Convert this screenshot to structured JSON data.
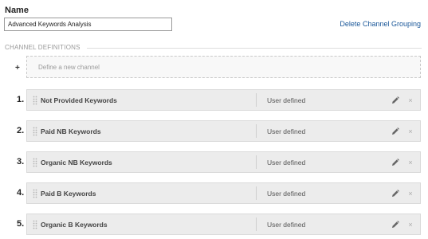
{
  "name_section": {
    "label": "Name",
    "value": "Advanced Keywords Analysis"
  },
  "delete_link": "Delete Channel Grouping",
  "channel_definitions": {
    "heading": "CHANNEL DEFINITIONS",
    "add_symbol": "+",
    "define_new_label": "Define a new channel",
    "channels": [
      {
        "number": "1.",
        "name": "Not Provided Keywords",
        "type": "User defined"
      },
      {
        "number": "2.",
        "name": "Paid NB Keywords",
        "type": "User defined"
      },
      {
        "number": "3.",
        "name": "Organic NB Keywords",
        "type": "User defined"
      },
      {
        "number": "4.",
        "name": "Paid B Keywords",
        "type": "User defined"
      },
      {
        "number": "5.",
        "name": "Organic B Keywords",
        "type": "User defined"
      }
    ],
    "close_glyph": "×"
  },
  "icons": {
    "grip": "drag-handle-icon",
    "edit": "pencil-icon",
    "close": "close-icon"
  },
  "colors": {
    "link": "#1a5799",
    "row_bg": "#ececec",
    "heading": "#999999"
  }
}
